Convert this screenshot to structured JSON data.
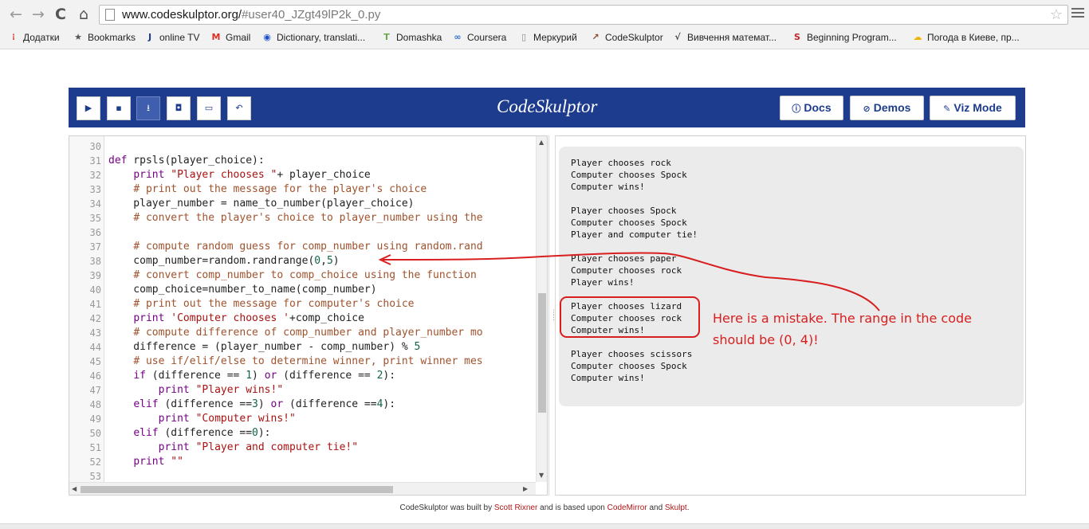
{
  "browser": {
    "url_host": "www.codeskulptor.org/",
    "url_hash": "#user40_JZgt49lP2k_0.py",
    "bookmarks": [
      {
        "label": "Додатки",
        "icon": "apps-grid-icon",
        "color": "#d9534f"
      },
      {
        "label": "Bookmarks",
        "icon": "star-icon",
        "color": "#555555"
      },
      {
        "label": "online TV",
        "icon": "ja-logo-icon",
        "color": "#1d3c8e"
      },
      {
        "label": "Gmail",
        "icon": "gmail-icon",
        "color": "#d93025"
      },
      {
        "label": "Dictionary, translati...",
        "icon": "dictionary-icon",
        "color": "#1a4fd0"
      },
      {
        "label": "Domashka",
        "icon": "t-icon",
        "color": "#6aa84f"
      },
      {
        "label": "Coursera",
        "icon": "coursera-icon",
        "color": "#2a73cc"
      },
      {
        "label": "Меркурий",
        "icon": "page-icon",
        "color": "#888888"
      },
      {
        "label": "CodeSkulptor",
        "icon": "codeskulptor-icon",
        "color": "#8a4b2a"
      },
      {
        "label": "Вивчення математ...",
        "icon": "math-icon",
        "color": "#444444"
      },
      {
        "label": "Beginning Program...",
        "icon": "s-icon",
        "color": "#c0262d"
      },
      {
        "label": "Погода в Киеве, пр...",
        "icon": "weather-icon",
        "color": "#f0b400"
      }
    ]
  },
  "app": {
    "title": "CodeSkulptor",
    "docs_label": "Docs",
    "demos_label": "Demos",
    "viz_label": "Viz Mode"
  },
  "editor": {
    "line_numbers": [
      "30",
      "31",
      "32",
      "33",
      "34",
      "35",
      "36",
      "37",
      "38",
      "39",
      "40",
      "41",
      "42",
      "43",
      "44",
      "45",
      "46",
      "47",
      "48",
      "49",
      "50",
      "51",
      "52",
      "53"
    ]
  },
  "output": {
    "lines": [
      "Player chooses rock",
      "Computer chooses Spock",
      "Computer wins!",
      "",
      "Player chooses Spock",
      "Computer chooses Spock",
      "Player and computer tie!",
      "",
      "Player chooses paper",
      "Computer chooses rock",
      "Player wins!",
      "",
      "Player chooses lizard",
      "Computer chooses rock",
      "Computer wins!",
      "",
      "Player chooses scissors",
      "Computer chooses Spock",
      "Computer wins!"
    ]
  },
  "annotation": {
    "line1": "Here is a mistake. The range in the code",
    "line2": "should be (0, 4)!",
    "color": "#d81e1e"
  },
  "footer": {
    "prefix": "CodeSkulptor was built by ",
    "author": "Scott Rixner",
    "middle": " and is based upon ",
    "lib1": "CodeMirror",
    "and": " and ",
    "lib2": "Skulpt",
    "end": "."
  }
}
